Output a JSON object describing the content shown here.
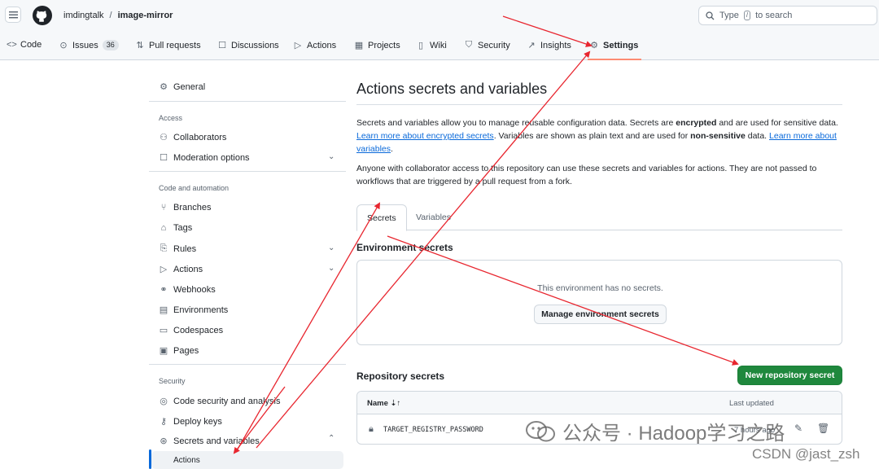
{
  "header": {
    "owner": "imdingtalk",
    "separator": "/",
    "repo": "image-mirror",
    "search_prefix": "Type",
    "search_key": "/",
    "search_suffix": "to search"
  },
  "repo_nav": {
    "code": "Code",
    "issues": "Issues",
    "issues_count": "36",
    "pull_requests": "Pull requests",
    "discussions": "Discussions",
    "actions": "Actions",
    "projects": "Projects",
    "wiki": "Wiki",
    "security": "Security",
    "insights": "Insights",
    "settings": "Settings"
  },
  "sidebar": {
    "general": "General",
    "access_heading": "Access",
    "collaborators": "Collaborators",
    "moderation": "Moderation options",
    "code_heading": "Code and automation",
    "branches": "Branches",
    "tags": "Tags",
    "rules": "Rules",
    "actions": "Actions",
    "webhooks": "Webhooks",
    "environments": "Environments",
    "codespaces": "Codespaces",
    "pages": "Pages",
    "security_heading": "Security",
    "code_security": "Code security and analysis",
    "deploy_keys": "Deploy keys",
    "secrets_variables": "Secrets and variables",
    "actions_sub": "Actions"
  },
  "main": {
    "title": "Actions secrets and variables",
    "desc_1": "Secrets and variables allow you to manage reusable configuration data. Secrets are ",
    "desc_bold1": "encrypted",
    "desc_2": " and are used for sensitive data. ",
    "desc_link1": "Learn more about encrypted secrets",
    "desc_3": ". Variables are shown as plain text and are used for ",
    "desc_bold2": "non-sensitive",
    "desc_4": " data. ",
    "desc_link2": "Learn more about variables",
    "desc_5": ".",
    "desc_access": "Anyone with collaborator access to this repository can use these secrets and variables for actions. They are not passed to workflows that are triggered by a pull request from a fork.",
    "tab_secrets": "Secrets",
    "tab_variables": "Variables",
    "env_title": "Environment secrets",
    "env_empty": "This environment has no secrets.",
    "manage_env_button": "Manage environment secrets",
    "repo_title": "Repository secrets",
    "new_secret_button": "New repository secret",
    "col_name": "Name",
    "col_updated": "Last updated",
    "secret_name": "TARGET_REGISTRY_PASSWORD",
    "secret_updated": "7 hours ago"
  },
  "watermark": {
    "text": "公众号 · Hadoop学习之路",
    "csdn": "CSDN @jast_zsh"
  },
  "colors": {
    "accent": "#0969da",
    "primary_button": "#1f883d",
    "annotation_arrow": "#e8262f",
    "selected_tab_underline": "#fd8c73"
  }
}
